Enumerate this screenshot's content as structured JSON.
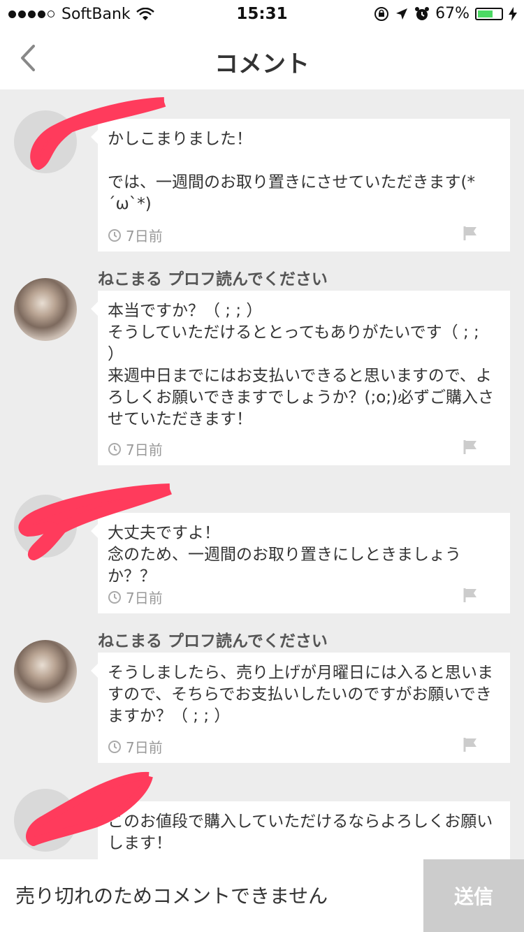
{
  "status_bar": {
    "carrier": "SoftBank",
    "time": "15:31",
    "battery": "67%",
    "battery_level": 0.67
  },
  "nav": {
    "title": "コメント"
  },
  "comments": [
    {
      "username": "",
      "text": "かしこまりました！\n\nでは、一週間のお取り置きにさせていただきます(*´ω`*)",
      "time": "7日前",
      "redacted": true
    },
    {
      "username": "ねこまる プロフ読んでください",
      "text": "本当ですか？（ ; ; ）\nそうしていただけるととってもありがたいです（ ; ; ）\n来週中日までにはお支払いできると思いますので、よろしくお願いできますでしょうか？(;o;)必ずご購入させていただきます！",
      "time": "7日前",
      "redacted": false
    },
    {
      "username": "",
      "text": "大丈夫ですよ！\n念のため、一週間のお取り置きにしときましょうか？？",
      "time": "7日前",
      "redacted": true
    },
    {
      "username": "ねこまる プロフ読んでください",
      "text": "そうしましたら、売り上げが月曜日には入ると思いますので、そちらでお支払いしたいのですがお願いできますか？（ ; ; ）",
      "time": "7日前",
      "redacted": false
    },
    {
      "username": "",
      "text": "このお値段で購入していただけるならよろしくお願いします！",
      "time": "",
      "redacted": true
    }
  ],
  "input": {
    "placeholder": "売り切れのためコメントできません"
  },
  "send_label": "送信",
  "colors": {
    "redaction": "#ff3b5c",
    "accent_bg": "#ededed",
    "send_disabled": "#cccccc"
  }
}
